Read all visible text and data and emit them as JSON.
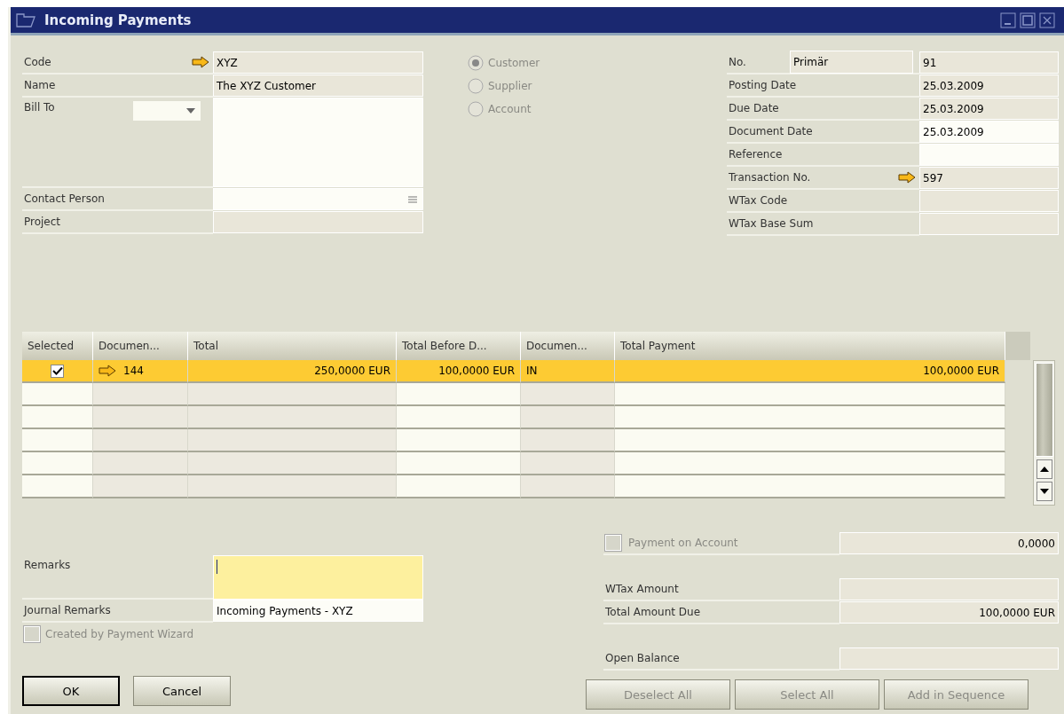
{
  "window": {
    "title": "Incoming Payments"
  },
  "partner": {
    "code": {
      "label": "Code",
      "value": "XYZ",
      "link": true
    },
    "name": {
      "label": "Name",
      "value": "The XYZ Customer"
    },
    "bill_to": {
      "label": "Bill To"
    },
    "contact_person": {
      "label": "Contact Person"
    },
    "project": {
      "label": "Project"
    }
  },
  "partner_type": [
    {
      "label": "Customer",
      "selected": true,
      "disabled": true
    },
    {
      "label": "Supplier",
      "selected": false,
      "disabled": true
    },
    {
      "label": "Account",
      "selected": false,
      "disabled": true
    }
  ],
  "document": {
    "number": {
      "label": "No.",
      "series": "Primär",
      "value": "91"
    },
    "fields": [
      {
        "label": "Posting Date",
        "value": "25.03.2009",
        "editable": false,
        "link": false
      },
      {
        "label": "Due Date",
        "value": "25.03.2009",
        "editable": false,
        "link": false
      },
      {
        "label": "Document Date",
        "value": "25.03.2009",
        "editable": true,
        "link": false
      },
      {
        "label": "Reference",
        "editable": true,
        "link": false
      },
      {
        "label": "Transaction No.",
        "value": "597",
        "editable": false,
        "link": true
      },
      {
        "label": "WTax Code",
        "editable": false,
        "link": false
      },
      {
        "label": "WTax Base Sum",
        "editable": false,
        "link": false
      }
    ]
  },
  "table": {
    "columns": [
      "Selected",
      "Documen...",
      "Total",
      "Total Before D...",
      "Documen...",
      "Total Payment"
    ],
    "rows": [
      {
        "selected": true,
        "checked": true,
        "link": true,
        "cells": [
          "",
          "144",
          "250,0000 EUR",
          "100,0000 EUR",
          "IN",
          "100,0000 EUR"
        ]
      }
    ]
  },
  "remarks": {
    "label": "Remarks",
    "focused": true
  },
  "journal_remarks": {
    "label": "Journal Remarks",
    "value": "Incoming Payments - XYZ"
  },
  "created_by_wizard": {
    "label": "Created by Payment Wizard",
    "checked": false,
    "disabled": true
  },
  "payment_on_account": {
    "label": "Payment on Account",
    "checked": false,
    "disabled": true,
    "value": "0,0000"
  },
  "wtax_amount": {
    "label": "WTax Amount"
  },
  "total_amount_due": {
    "label": "Total Amount Due",
    "value": "100,0000 EUR"
  },
  "open_balance": {
    "label": "Open Balance"
  },
  "left_buttons": [
    {
      "label": "OK",
      "default": true,
      "disabled": false
    },
    {
      "label": "Cancel",
      "default": false,
      "disabled": false
    }
  ],
  "right_buttons": [
    {
      "label": "Deselect All",
      "default": false,
      "disabled": true
    },
    {
      "label": "Select All",
      "default": false,
      "disabled": true
    },
    {
      "label": "Add in Sequence",
      "default": false,
      "disabled": true
    }
  ]
}
